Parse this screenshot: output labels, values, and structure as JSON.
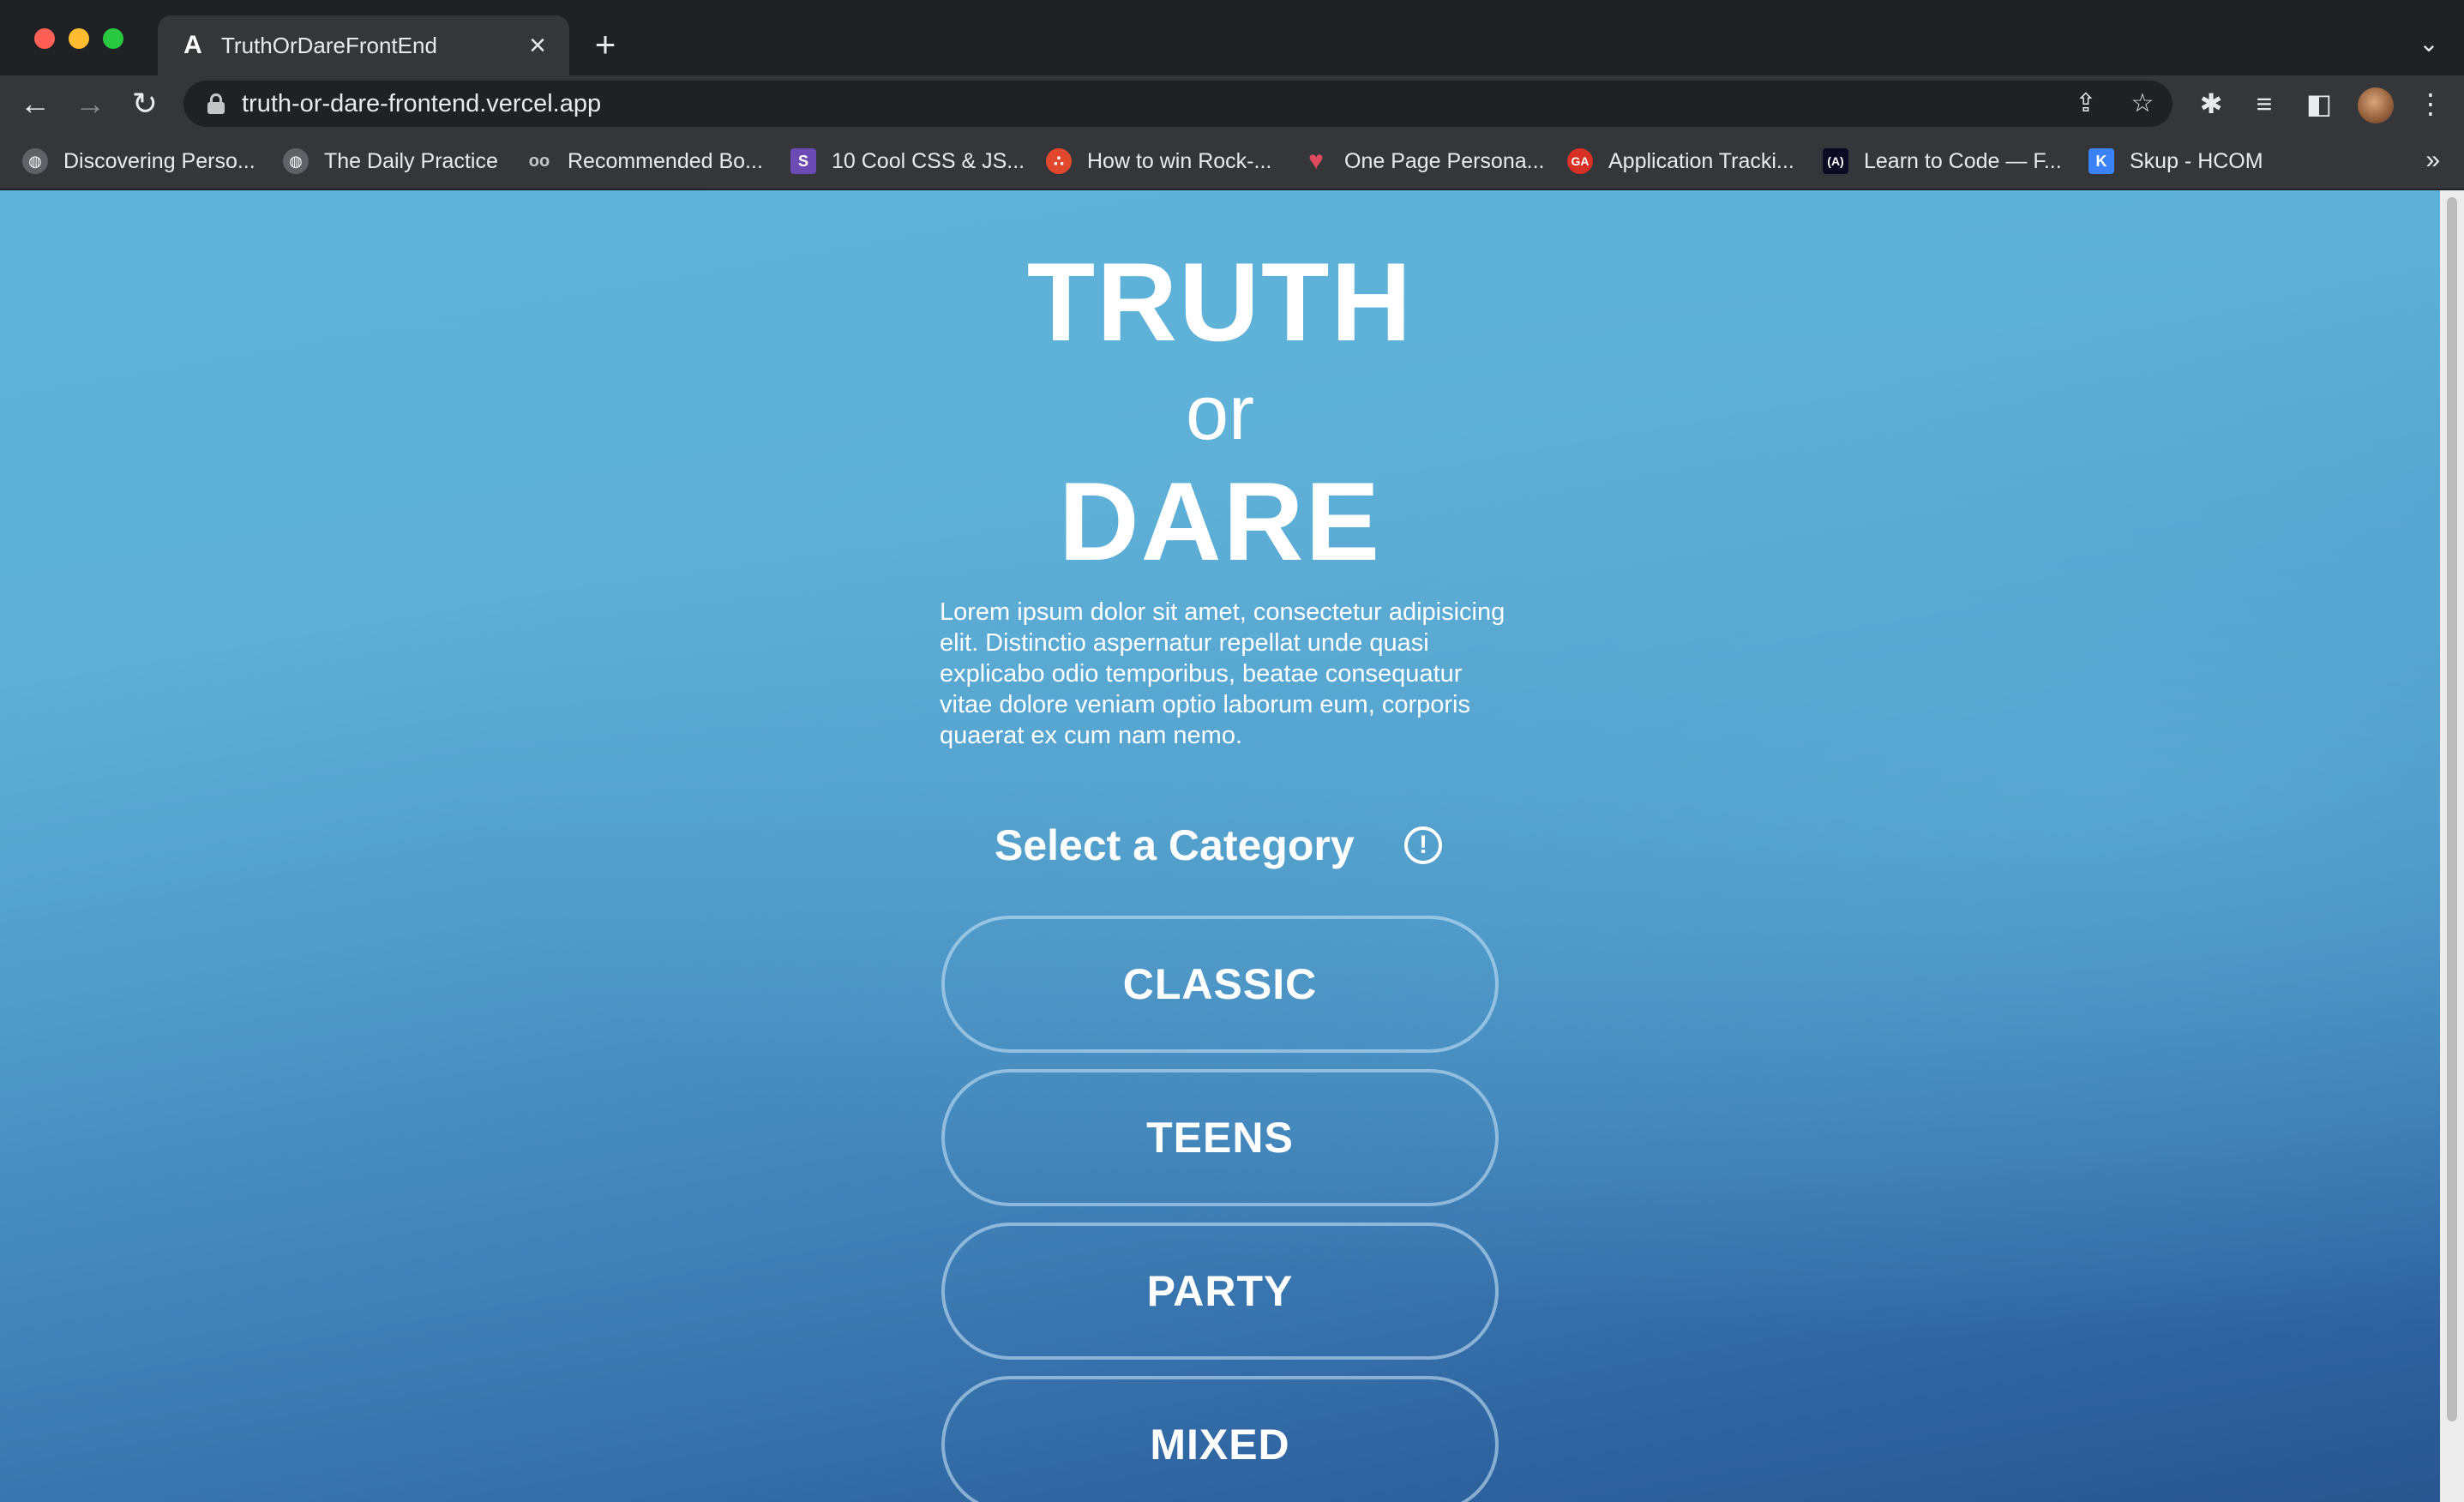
{
  "browser": {
    "tab": {
      "title": "TruthOrDareFrontEnd",
      "favicon": "A"
    },
    "url": "truth-or-dare-frontend.vercel.app",
    "bookmarks": [
      {
        "label": "Discovering Perso...",
        "icon": "globe-icon"
      },
      {
        "label": "The Daily Practice",
        "icon": "globe-icon"
      },
      {
        "label": "Recommended Bo...",
        "icon": "glasses-icon"
      },
      {
        "label": "10 Cool CSS & JS...",
        "icon": "code-icon"
      },
      {
        "label": "How to win Rock-...",
        "icon": "dots-icon"
      },
      {
        "label": "One Page Persona...",
        "icon": "heart-icon"
      },
      {
        "label": "Application Tracki...",
        "icon": "ga-icon"
      },
      {
        "label": "Learn to Code — F...",
        "icon": "fcc-icon"
      },
      {
        "label": "Skup - HCOM",
        "icon": "k-icon"
      }
    ]
  },
  "page": {
    "title_top": "TRUTH",
    "title_mid": "or",
    "title_bottom": "DARE",
    "description": "Lorem ipsum dolor sit amet, consectetur adipisicing elit. Distinctio aspernatur repellat unde quasi explicabo odio temporibus, beatae consequatur vitae dolore veniam optio laborum eum, corporis quaerat ex cum nam nemo.",
    "category_heading": "Select a Category",
    "info_symbol": "!",
    "categories": [
      "CLASSIC",
      "TEENS",
      "PARTY",
      "MIXED"
    ]
  },
  "colors": {
    "gradient_top": "#5fb3d8",
    "gradient_bottom": "#28568f",
    "button_border": "#c4e0f4"
  }
}
